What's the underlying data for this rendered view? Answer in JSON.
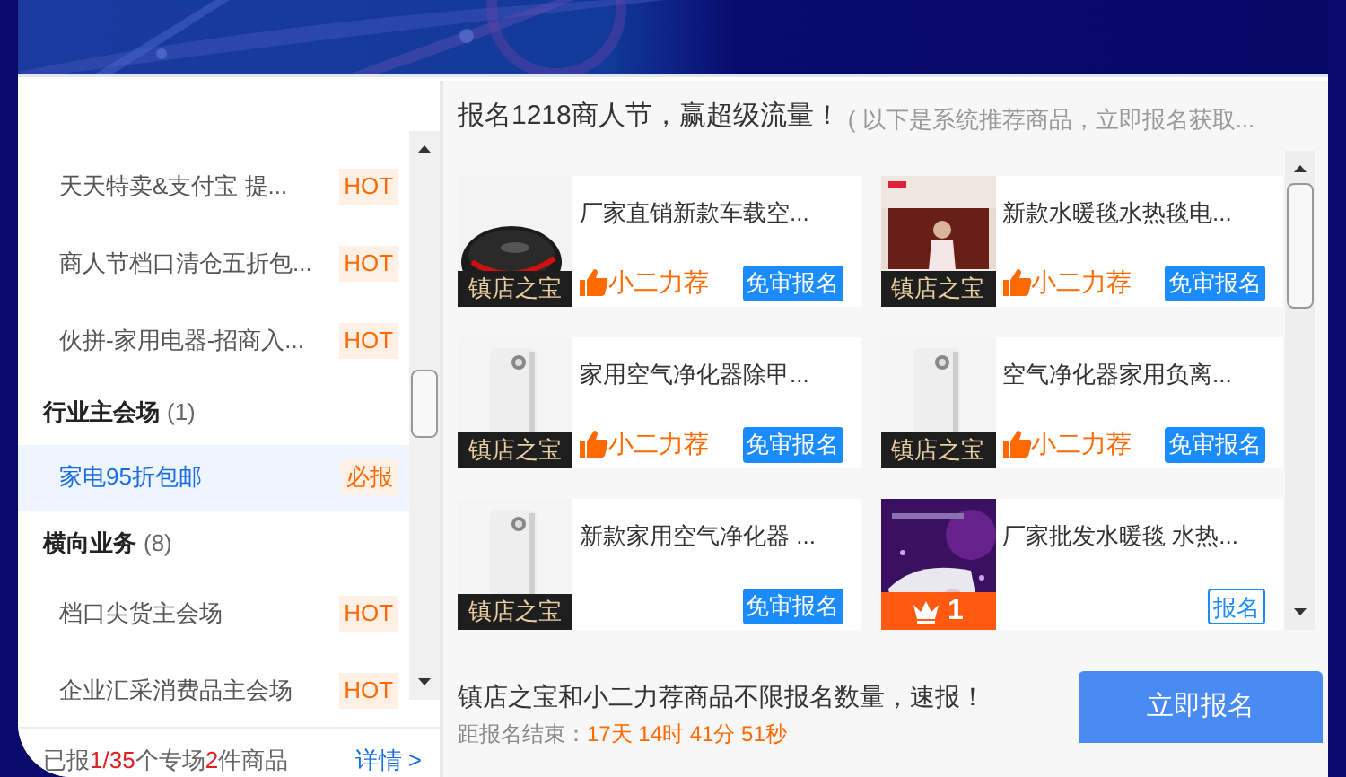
{
  "sidebar": {
    "rows": [
      {
        "kind": "item",
        "label": "天天特卖&支付宝 提...",
        "tag": "HOT",
        "selected": false
      },
      {
        "kind": "item",
        "label": "商人节档口清仓五折包...",
        "tag": "HOT",
        "selected": false
      },
      {
        "kind": "item",
        "label": "伙拼-家用电器-招商入...",
        "tag": "HOT",
        "selected": false
      },
      {
        "kind": "header",
        "label": "行业主会场",
        "count": "(1)"
      },
      {
        "kind": "item",
        "label": "家电95折包邮",
        "tag": "必报",
        "selected": true
      },
      {
        "kind": "header",
        "label": "横向业务",
        "count": "(8)"
      },
      {
        "kind": "item",
        "label": "档口尖货主会场",
        "tag": "HOT",
        "selected": false
      },
      {
        "kind": "item",
        "label": "企业汇采消费品主会场",
        "tag": "HOT",
        "selected": false
      }
    ],
    "summary_parts": [
      {
        "text": "已报",
        "highlight": false
      },
      {
        "text": "1/35",
        "highlight": true
      },
      {
        "text": "个专场",
        "highlight": false
      },
      {
        "text": "2",
        "highlight": true
      },
      {
        "text": "件商品",
        "highlight": false
      }
    ],
    "details_link": "详情 >"
  },
  "main": {
    "title": "报名1218商人节，赢超级流量！",
    "subtitle": "( 以下是系统推荐商品，立即报名获取...",
    "products": [
      {
        "name": "厂家直销新款车载空...",
        "badge": {
          "kind": "treasure",
          "text": "镇店之宝"
        },
        "recommend": "小二力荐",
        "action": {
          "label": "免审报名",
          "kind": "filled"
        }
      },
      {
        "name": "新款水暖毯水热毯电...",
        "badge": {
          "kind": "treasure",
          "text": "镇店之宝"
        },
        "recommend": "小二力荐",
        "action": {
          "label": "免审报名",
          "kind": "filled"
        }
      },
      {
        "name": "家用空气净化器除甲...",
        "badge": {
          "kind": "treasure",
          "text": "镇店之宝"
        },
        "recommend": "小二力荐",
        "action": {
          "label": "免审报名",
          "kind": "filled"
        }
      },
      {
        "name": "空气净化器家用负离...",
        "badge": {
          "kind": "treasure",
          "text": "镇店之宝"
        },
        "recommend": "小二力荐",
        "action": {
          "label": "免审报名",
          "kind": "filled"
        }
      },
      {
        "name": "新款家用空气净化器 ...",
        "badge": {
          "kind": "treasure",
          "text": "镇店之宝"
        },
        "action": {
          "label": "免审报名",
          "kind": "filled"
        }
      },
      {
        "name": "厂家批发水暖毯 水热...",
        "badge": {
          "kind": "rank",
          "text": "1"
        },
        "action": {
          "label": "报名",
          "kind": "outline"
        }
      }
    ],
    "notice": "镇店之宝和小二力荐商品不限报名数量，速报！",
    "countdown_label": "距报名结束：",
    "countdown": "17天 14时 41分 51秒",
    "submit": "立即报名"
  }
}
